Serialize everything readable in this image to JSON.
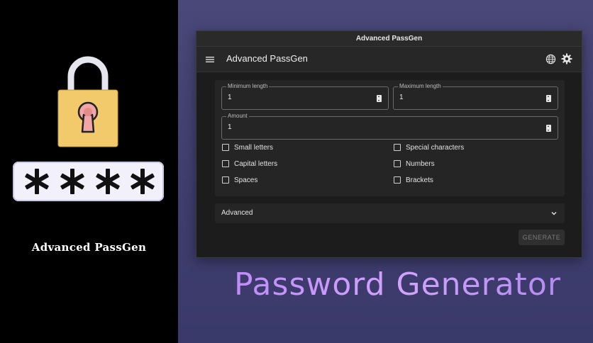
{
  "promo": {
    "brand_title": "Advanced PassGen",
    "tagline": "Password Generator",
    "lock_icon": "padlock-icon",
    "masked_icon": "masked-password-icon"
  },
  "window": {
    "title": "Advanced PassGen"
  },
  "appbar": {
    "title": "Advanced PassGen",
    "menu_icon": "hamburger-menu-icon",
    "language_icon": "globe-icon",
    "settings_icon": "gear-icon"
  },
  "form": {
    "min_length": {
      "label": "Minimum length",
      "value": "1"
    },
    "max_length": {
      "label": "Maximum length",
      "value": "1"
    },
    "amount": {
      "label": "Amount",
      "value": "1"
    },
    "checkboxes": {
      "small_letters": {
        "label": "Small letters",
        "checked": false
      },
      "capital_letters": {
        "label": "Capital letters",
        "checked": false
      },
      "spaces": {
        "label": "Spaces",
        "checked": false
      },
      "special_characters": {
        "label": "Special characters",
        "checked": false
      },
      "numbers": {
        "label": "Numbers",
        "checked": false
      },
      "brackets": {
        "label": "Brackets",
        "checked": false
      }
    }
  },
  "advanced": {
    "label": "Advanced",
    "chevron_icon": "chevron-down-icon"
  },
  "actions": {
    "generate_label": "GENERATE"
  },
  "colors": {
    "window_bg": "#1c1c1c",
    "card_bg": "#252525",
    "promo_bg": "#4a4878",
    "lock_body": "#f2c96b",
    "tagline": "#c69af8"
  }
}
